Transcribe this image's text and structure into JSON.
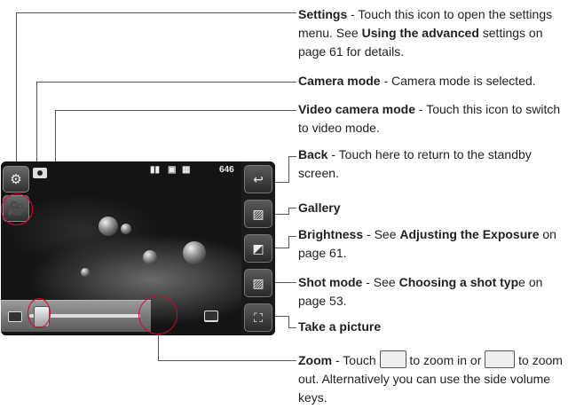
{
  "callouts": {
    "settings": {
      "title": "Settings",
      "text_a": " - Touch this icon to open the settings menu. See ",
      "bold": "Using the advanced",
      "text_b": " settings on page 61 for details."
    },
    "camera_mode": {
      "title": "Camera mode",
      "text": " - Camera mode is selected."
    },
    "video_mode": {
      "title": "Video camera mode",
      "text": " - Touch this icon to switch to video mode."
    },
    "back": {
      "title": "Back",
      "text": " - Touch here to return to the standby screen."
    },
    "gallery": {
      "title": "Gallery"
    },
    "brightness": {
      "title": "Brightness",
      "text_a": " - See ",
      "bold": "Adjusting the Exposure",
      "text_b": " on page 61."
    },
    "shot_mode": {
      "title": "Shot mode",
      "text_a": " - See ",
      "bold": "Choosing a shot typ",
      "text_b": "e on page 53."
    },
    "take_picture": {
      "title": "Take a picture"
    },
    "zoom": {
      "title": "Zoom",
      "text_a": " - Touch ",
      "text_b": " to zoom in or ",
      "text_c": " to zoom out. Alternatively you can use the side volume keys."
    }
  },
  "screen": {
    "shot_count": "646"
  },
  "icons": {
    "settings": "gear-icon",
    "camera": "camera-icon",
    "video": "video-camera-icon",
    "back": "back-arrow-icon",
    "gallery": "gallery-icon",
    "brightness": "brightness-icon",
    "shot_mode": "shot-mode-icon",
    "shutter": "shutter-icon",
    "zoom_in": "zoom-in-icon",
    "zoom_out": "zoom-out-icon",
    "battery": "battery-icon",
    "memory": "memory-icon",
    "size": "size-icon"
  },
  "colors": {
    "accent": "#e2002a",
    "text": "#231f20"
  },
  "zoom_level": 0.05
}
